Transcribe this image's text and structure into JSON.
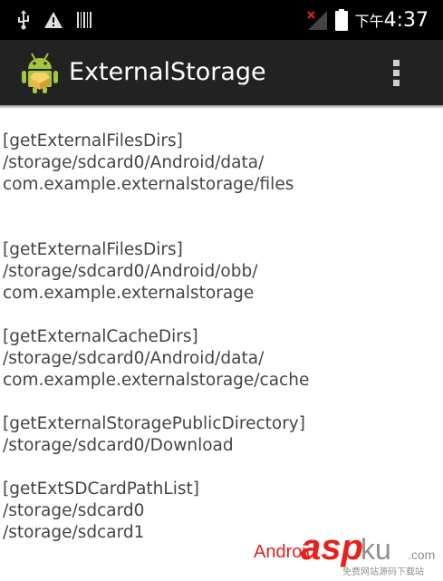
{
  "status_bar": {
    "time_prefix": "下午",
    "time": "4:37",
    "icons": [
      "usb-icon",
      "warning-icon",
      "barcode-icon",
      "signal-icon",
      "battery-icon"
    ]
  },
  "action_bar": {
    "title": "ExternalStorage",
    "app_icon": "android-icon",
    "overflow_icon": "overflow-menu-icon",
    "background": "#222222"
  },
  "content": {
    "blocks": [
      {
        "lines": [
          "[getExternalFilesDirs]",
          "/storage/sdcard0/Android/data/",
          "com.example.externalstorage/files"
        ]
      },
      {
        "lines": [
          "[getExternalFilesDirs]",
          "/storage/sdcard0/Android/obb/",
          "com.example.externalstorage"
        ]
      },
      {
        "lines": [
          "[getExternalCacheDirs]",
          "/storage/sdcard0/Android/data/",
          "com.example.externalstorage/cache"
        ]
      },
      {
        "lines": [
          "[getExternalStoragePublicDirectory]",
          "/storage/sdcard0/Download"
        ]
      },
      {
        "lines": [
          "[getExtSDCardPathList]",
          "/storage/sdcard0",
          "/storage/sdcard1"
        ]
      }
    ]
  },
  "watermark": {
    "prefix": "Android",
    "brand": "asp",
    "brand_suffix": "ku",
    "domain": ".com",
    "subtitle": "免费网站源码下载站"
  }
}
